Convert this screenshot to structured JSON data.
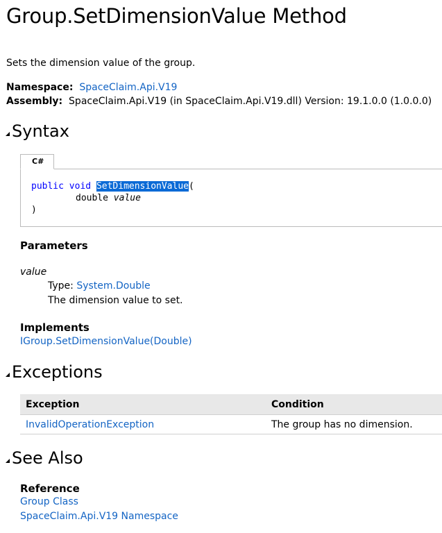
{
  "title": "Group.SetDimensionValue Method",
  "summary": "Sets the dimension value of the group.",
  "namespace": {
    "label": "Namespace:",
    "value": "SpaceClaim.Api.V19"
  },
  "assembly": {
    "label": "Assembly:",
    "value": "SpaceClaim.Api.V19 (in SpaceClaim.Api.V19.dll) Version: 19.1.0.0 (1.0.0.0)"
  },
  "sections": {
    "syntax": "Syntax",
    "exceptions": "Exceptions",
    "see_also": "See Also"
  },
  "code": {
    "tab": "C#",
    "kw_public": "public",
    "kw_void": "void",
    "method": "SetDimensionValue",
    "open": "(",
    "param_type": "double",
    "param_name": "value",
    "close": ")"
  },
  "parameters": {
    "heading": "Parameters",
    "name": "value",
    "type_label": "Type:",
    "type_value": "System.Double",
    "description": "The dimension value to set."
  },
  "implements": {
    "heading": "Implements",
    "link": "IGroup.SetDimensionValue(Double)"
  },
  "exceptions_table": {
    "headers": [
      "Exception",
      "Condition"
    ],
    "rows": [
      {
        "exception": "InvalidOperationException",
        "condition": "The group has no dimension."
      }
    ]
  },
  "see_also": {
    "heading": "Reference",
    "links": [
      "Group Class",
      "SpaceClaim.Api.V19 Namespace"
    ]
  },
  "colors": {
    "link": "#1364c4",
    "keyword": "#0000ff",
    "selection": "#0a6ad6",
    "table_header": "#e8e8e8"
  }
}
